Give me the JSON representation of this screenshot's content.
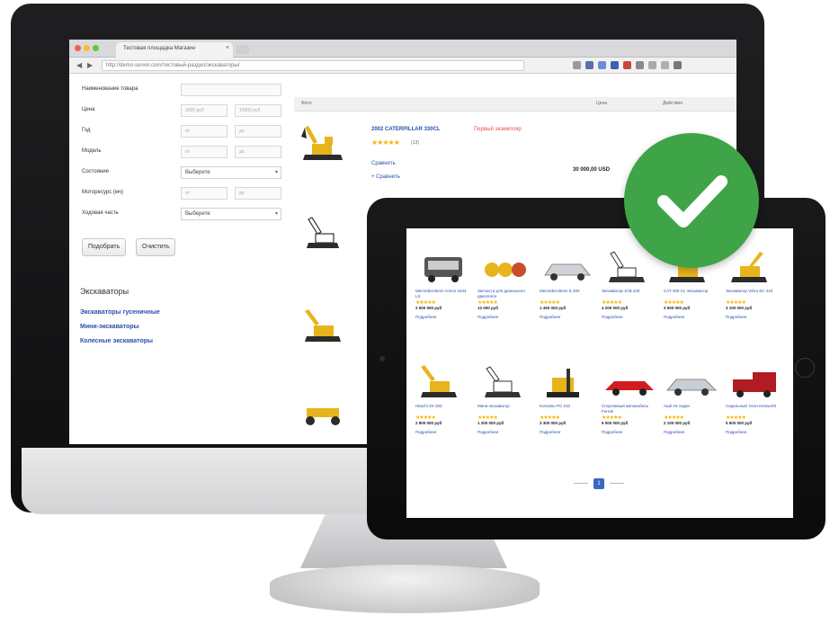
{
  "browser": {
    "tab_title": "Тестовая площадка Магазин",
    "tab_close": "×",
    "url": "http://demo-server.com/тестовый-раздел/экскаваторы/",
    "back_icon": "back-arrow-icon",
    "forward_icon": "forward-arrow-icon"
  },
  "filters": {
    "name_label": "Наименование товара",
    "price_label": "Цена",
    "year_label": "Год",
    "model_label": "Модель",
    "condition_label": "Состояние",
    "hours_label": "Моторесурс (мч)",
    "drive_label": "Ходовая часть",
    "price_from": "3000 руб",
    "price_to": "10000 руб",
    "range_from": "от",
    "range_to": "до",
    "select_placeholder": "Выберите",
    "submit_button": "Подобрать",
    "reset_button": "Очистить"
  },
  "categories": {
    "title": "Экскаваторы",
    "links": [
      "Экскаваторы гусеничные",
      "Мини-экскаваторы",
      "Колесные экскаваторы"
    ]
  },
  "list": {
    "col_name": "Фото",
    "col_price": "Цена",
    "col_action": "Действия",
    "first_product": {
      "title": "2002 CATERPILLAR 330CL",
      "instock": "Первый экземпляр",
      "stars": "★★★★★",
      "rating_count": "(13)",
      "compare_link": "Сравнить",
      "favorite_link": "+ Сравнить",
      "price": "30 000,00 USD"
    }
  },
  "tablet": {
    "cards_row1": [
      {
        "title": "Mercedes-Benz Actros 1844 LS",
        "stars": "★★★★★",
        "price": "2 500 000 руб",
        "more": "Подробнее"
      },
      {
        "title": "Запчасти для дизельного двигателя",
        "stars": "★★★★★",
        "price": "12 000 руб",
        "more": "Подробнее"
      },
      {
        "title": "Mercedes-Benz E 200",
        "stars": "★★★★★",
        "price": "1 450 000 руб",
        "more": "Подробнее"
      },
      {
        "title": "Экскаватор JCB 220",
        "stars": "★★★★★",
        "price": "4 200 000 руб",
        "more": "Подробнее"
      },
      {
        "title": "CAT 330 CL Экскаватор",
        "stars": "★★★★★",
        "price": "3 900 000 руб",
        "more": "Подробнее"
      },
      {
        "title": "Экскаватор Volvo EC 210",
        "stars": "★★★★★",
        "price": "3 100 000 руб",
        "more": "Подробнее"
      }
    ],
    "cards_row2": [
      {
        "title": "Hitachi ZX 200",
        "stars": "★★★★★",
        "price": "2 800 000 руб",
        "more": "Подробнее"
      },
      {
        "title": "Мини-экскаватор",
        "stars": "★★★★★",
        "price": "1 200 000 руб",
        "more": "Подробнее"
      },
      {
        "title": "Komatsu PC 210",
        "stars": "★★★★★",
        "price": "3 300 000 руб",
        "more": "Подробнее"
      },
      {
        "title": "Спортивный автомобиль Ferrari",
        "stars": "★★★★★",
        "price": "9 000 000 руб",
        "more": "Подробнее"
      },
      {
        "title": "Audi A6 седан",
        "stars": "★★★★★",
        "price": "2 100 000 руб",
        "more": "Подробнее"
      },
      {
        "title": "Седельный тягач Kenworth",
        "stars": "★★★★★",
        "price": "5 600 000 руб",
        "more": "Подробнее"
      }
    ],
    "pager_current": "1"
  },
  "colors": {
    "link": "#2a4fb0",
    "star": "#f5b400",
    "check_green": "#3fa447",
    "excavator_yellow": "#e8b41c"
  },
  "icons": {
    "badge": "checkmark-icon"
  }
}
